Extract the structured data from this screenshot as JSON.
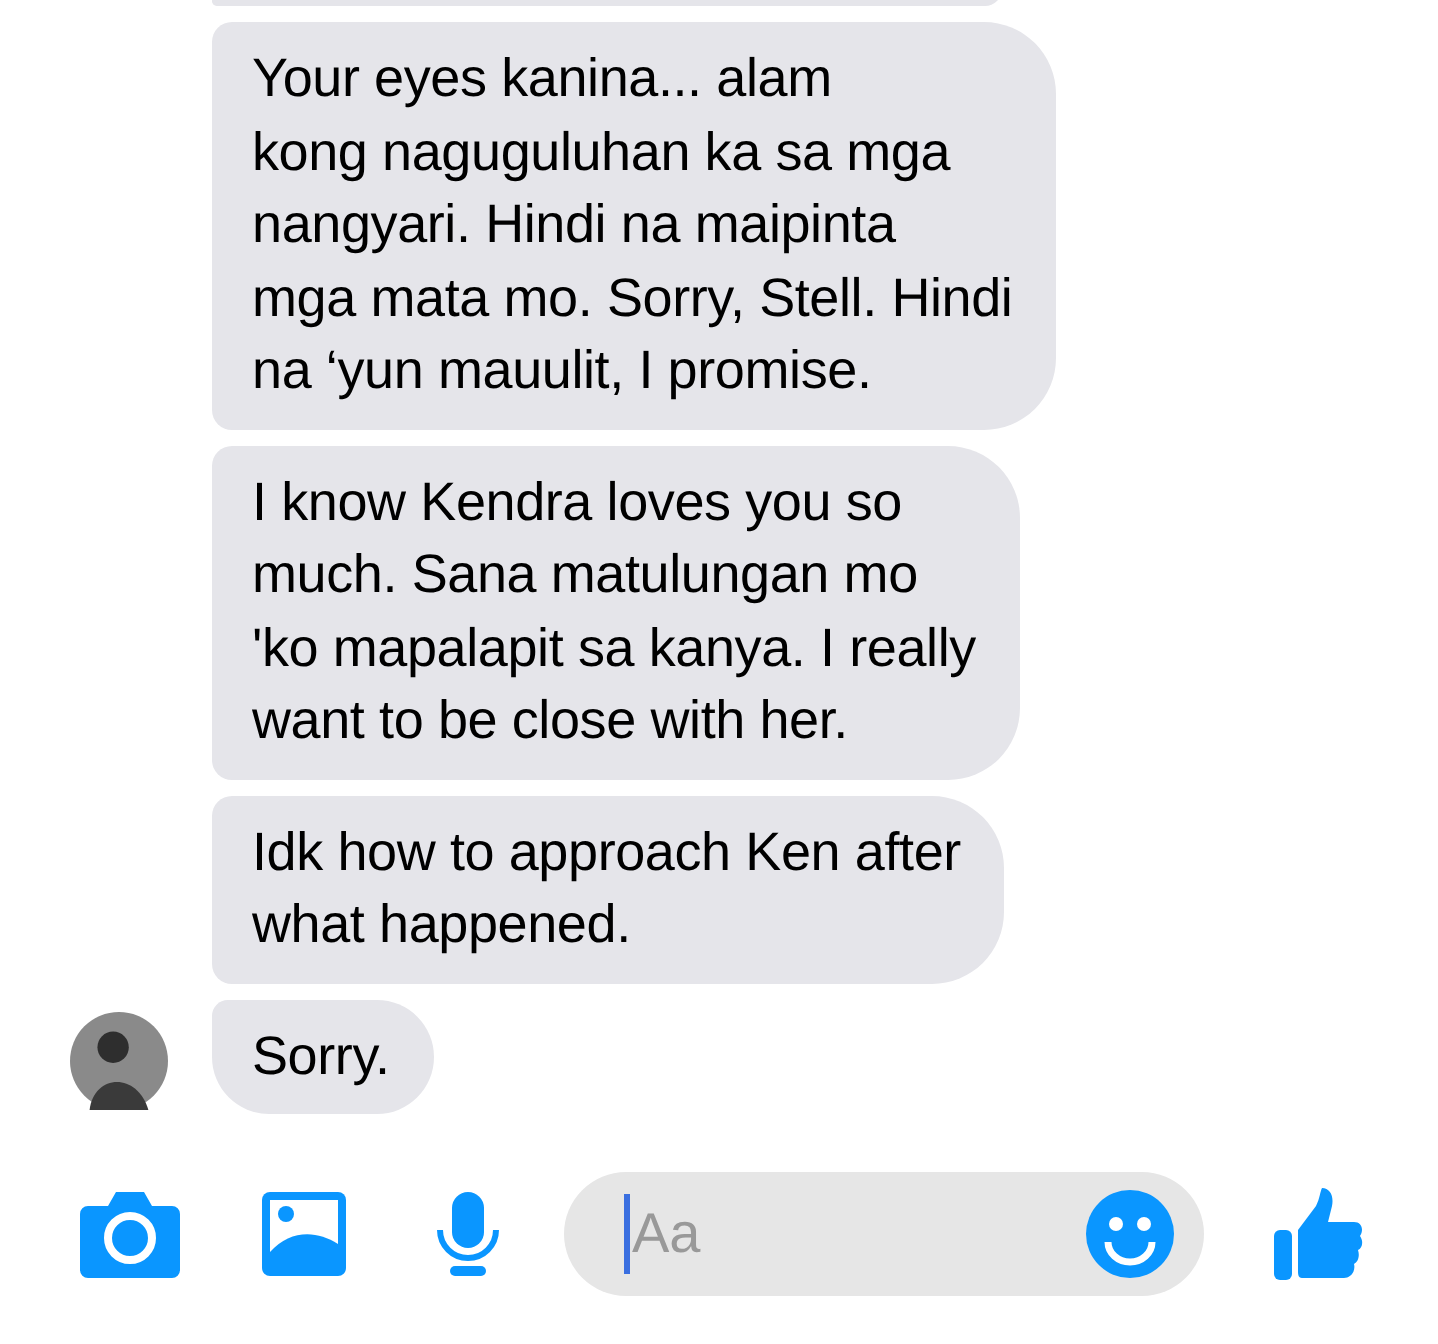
{
  "messages": [
    {
      "text": "Your eyes kanina... alam\nkong naguguluhan ka sa mga\nnangyari. Hindi na maipinta\nmga mata mo. Sorry, Stell. Hindi\nna ‘yun mauulit, I promise.",
      "avatar": false
    },
    {
      "text": "I know Kendra loves you so\nmuch. Sana matulungan mo\n'ko mapalapit sa kanya. I really\nwant to be close with her.",
      "avatar": false
    },
    {
      "text": "Idk how to approach Ken after\nwhat happened.",
      "avatar": false
    },
    {
      "text": "Sorry.",
      "avatar": true
    }
  ],
  "composer": {
    "placeholder": "Aa"
  }
}
